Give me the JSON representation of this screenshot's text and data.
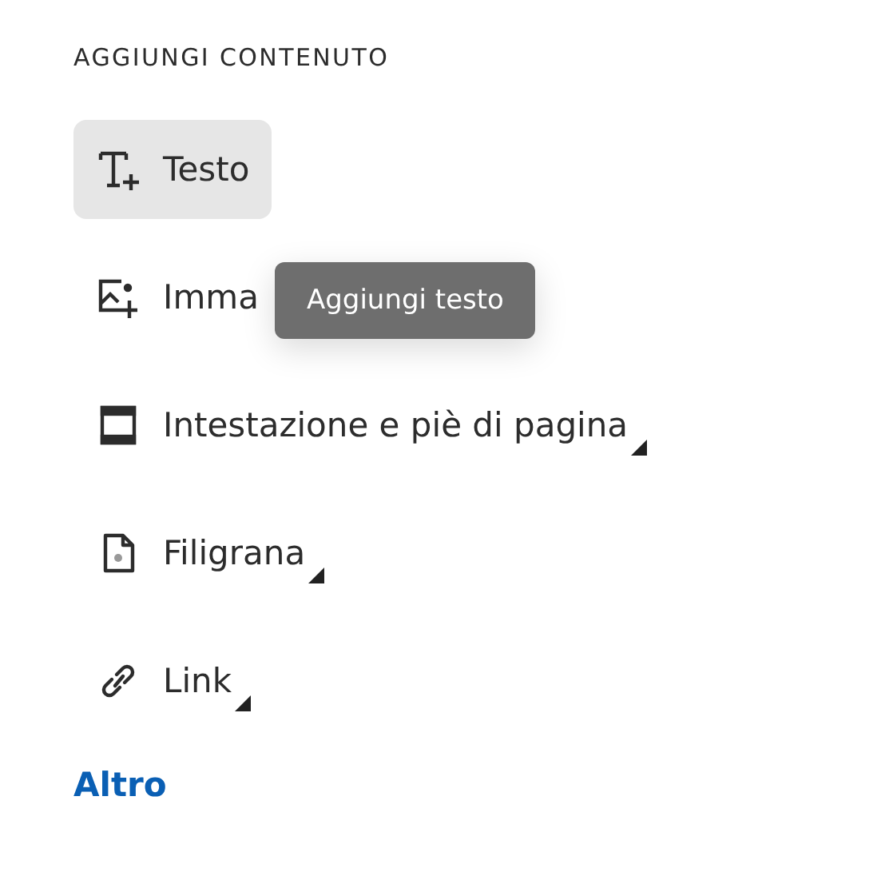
{
  "heading": "AGGIUNGI CONTENUTO",
  "items": [
    {
      "kind": "text",
      "label": "Testo",
      "selected": true,
      "submenu": false
    },
    {
      "kind": "image",
      "label": "Imma",
      "selected": false,
      "submenu": false
    },
    {
      "kind": "header-footer",
      "label": "Intestazione e piè di pagina",
      "selected": false,
      "submenu": true
    },
    {
      "kind": "watermark",
      "label": "Filigrana",
      "selected": false,
      "submenu": true
    },
    {
      "kind": "link",
      "label": "Link",
      "selected": false,
      "submenu": true
    }
  ],
  "tooltip": "Aggiungi testo",
  "more_link": "Altro"
}
